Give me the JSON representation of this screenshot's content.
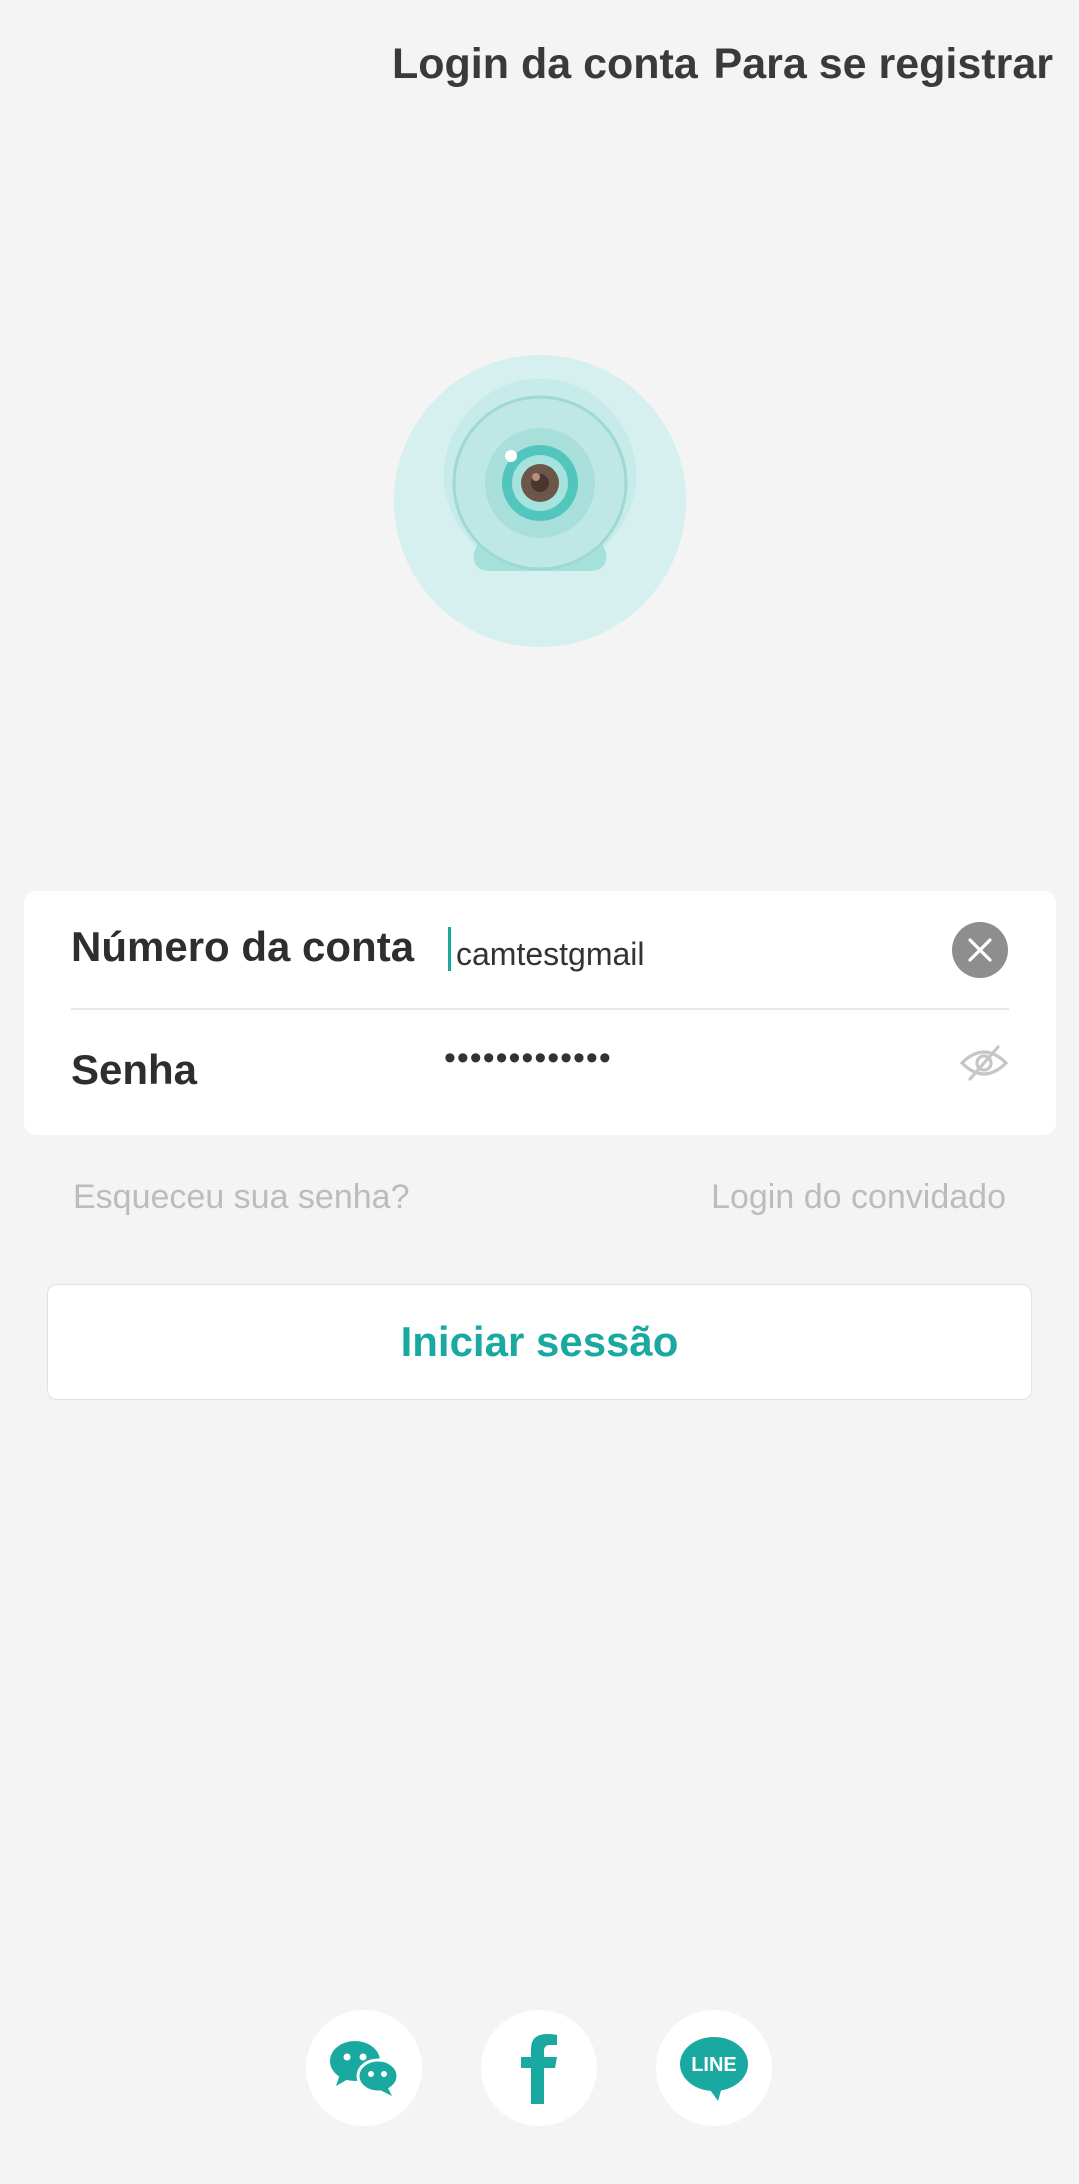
{
  "header": {
    "login_tab": "Login da conta",
    "register_tab": "Para se registrar"
  },
  "form": {
    "account_label": "Número da conta",
    "account_value": "camtestgmail",
    "password_label": "Senha",
    "password_masked": "•••••••••••••"
  },
  "links": {
    "forgot_password": "Esqueceu sua senha?",
    "guest_login": "Login do convidado"
  },
  "signin_button": "Iniciar sessão",
  "social": {
    "line_text": "LINE",
    "icons": [
      "wechat-icon",
      "facebook-icon",
      "line-icon"
    ]
  },
  "colors": {
    "accent": "#1aa9a0",
    "background": "#f4f4f4"
  }
}
